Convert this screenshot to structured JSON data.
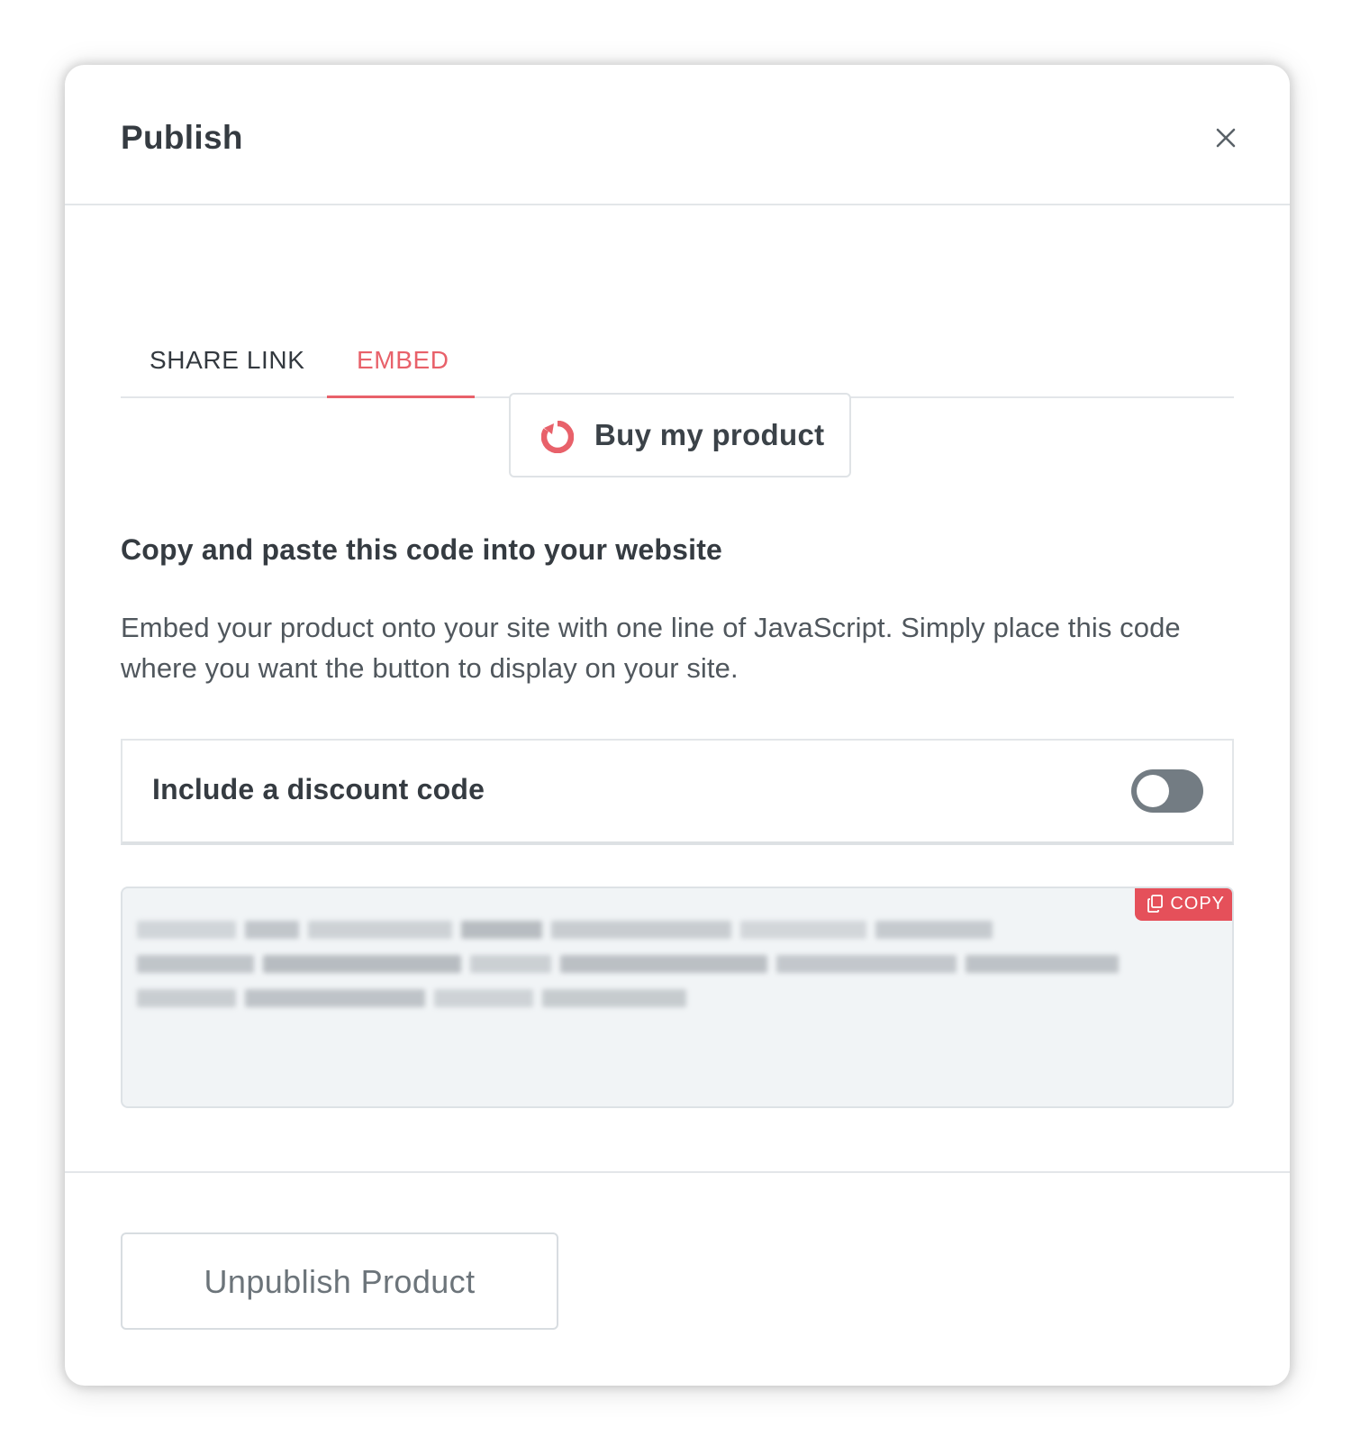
{
  "modal": {
    "title": "Publish"
  },
  "tabs": [
    {
      "label": "SHARE LINK",
      "active": false
    },
    {
      "label": "EMBED",
      "active": true
    }
  ],
  "preview_button": {
    "label": "Buy my product",
    "icon": "brand-logo-icon"
  },
  "embed": {
    "heading": "Copy and paste this code into your website",
    "description": "Embed your product onto your site with one line of JavaScript. Simply place this code where you want the button to display on your site."
  },
  "discount": {
    "label": "Include a discount code",
    "enabled": false
  },
  "code": {
    "copy_label": "COPY"
  },
  "footer": {
    "unpublish_label": "Unpublish Product"
  },
  "colors": {
    "accent": "#e8616a",
    "copy_badge": "#e5505a",
    "toggle_off": "#737c83",
    "code_background": "#f1f4f6"
  }
}
